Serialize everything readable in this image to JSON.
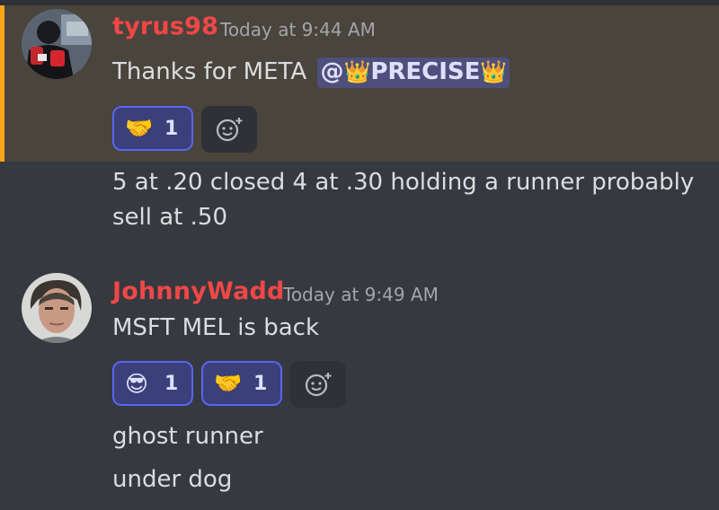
{
  "messages": [
    {
      "author": "tyrus98",
      "timestamp": "Today at 9:44 AM",
      "text": "Thanks for META",
      "mention": {
        "at": "@",
        "name": "PRECISE",
        "crown": "👑"
      },
      "reactions": [
        {
          "emoji": "🤝",
          "count": "1"
        }
      ]
    },
    {
      "text_line1": "5 at .20 closed 4 at .30 holding a runner probably",
      "text_line2": "sell at .50"
    },
    {
      "author": "JohnnyWadd",
      "timestamp": "Today at 9:49 AM",
      "text": "MSFT MEL is back",
      "reactions": [
        {
          "emoji": "😎",
          "count": "1"
        },
        {
          "emoji": "🤝",
          "count": "1"
        }
      ]
    },
    {
      "text": "ghost runner"
    },
    {
      "text": "under dog"
    }
  ],
  "icons": {
    "add_reaction": "add-reaction-icon"
  },
  "colors": {
    "background": "#36393f",
    "highlight_background": "#49443c",
    "highlight_bar": "#faa61a",
    "author": "#f04747",
    "mention_bg": "#5865f2",
    "reaction_border": "#5865f2"
  }
}
